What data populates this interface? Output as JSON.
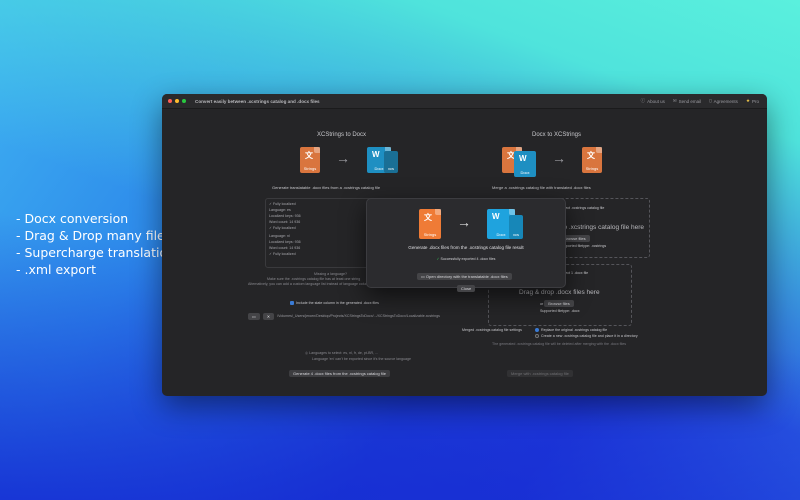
{
  "features": [
    "- Docx conversion",
    "- Drag & Drop many files",
    "- Supercharge translations",
    "- .xml export"
  ],
  "window": {
    "title": "Convert easily between .xcstrings catalog and .docx files",
    "toolbar": {
      "about": "About us",
      "email": "Send email",
      "agreements": "Agreements",
      "pro": "Pro"
    }
  },
  "left": {
    "heading": "XCStrings to Docx",
    "desc": "Generate translatable .docx files from a .xcstrings catalog file",
    "strings_label": "Strings",
    "docx_label": "Docx",
    "xcs_label": "xcs",
    "fully_localized": "Fully localized",
    "langs": [
      {
        "name": "Language: es",
        "keys": "Localized keys: 936",
        "words": "Word count: 14 936"
      },
      {
        "name": "Language: nl",
        "keys": "Localized keys: 936",
        "words": "Word count: 14 936"
      }
    ],
    "note1": "Missing a language?",
    "note2": "Make sure the .xcstrings catalog file has at least one string",
    "note3": "Alternatively, you can add a custom language list instead of language columns",
    "include_label": "Include the state column in the generated .docx files",
    "path": "/Volumes/_Users/jeroen/Desktop/Projects/XCStringsToDocx/.../XCStringsToDocx/Localizable.xcstrings",
    "langs_count_label": "Languages to select: es, nl, fr, de, pt-BR, ...",
    "footer_note": "Language 'en' can't be exported since it's the source language",
    "generate_button": "Generate 4 .docx files from the .xcstrings catalog file"
  },
  "right": {
    "heading": "Docx to XCStrings",
    "desc": "Merge a .xcstrings catalog file with translated .docx files",
    "drop1": "Drag & drop .xcstrings catalog file here",
    "drop1_small": "Select .xcstrings catalog file",
    "browse": "Browse files",
    "supported1": "Supported filetype: .xcstrings",
    "drop2": "Drag & drop .docx files here",
    "drop2_small": "Select 1 .docx file",
    "or": "or",
    "supported2": "Supported filetype: .docx",
    "merge_label": "Merged .xcstrings catalog file settings",
    "opt1": "Replace the original .xcstrings catalog file",
    "opt2": "Create a new .xcstrings catalog file and place it in a directory",
    "merge_note": "The generated .xcstrings catalog file will be deleted after merging with the .docx files",
    "merge_button": "Merge with .xcstrings catalog file"
  },
  "modal": {
    "title": "Generate .docx files from the .xcstrings catalog file result",
    "success": "Successfully exported 4 .docx files",
    "open_dir": "Open directory with the translatable .docx files",
    "close": "Close",
    "strings": "Strings",
    "docx": "Docx",
    "xcs": "xcs"
  }
}
